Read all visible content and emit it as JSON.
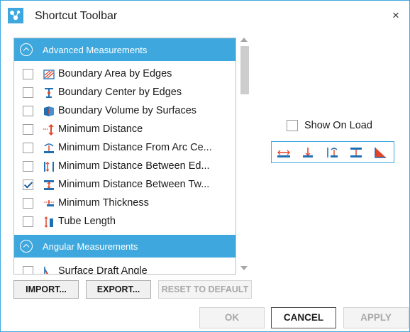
{
  "window": {
    "title": "Shortcut Toolbar",
    "close_glyph": "×",
    "app_icon": "toolbar-app-icon"
  },
  "groups": [
    {
      "label": "Advanced Measurements",
      "items": [
        {
          "label": "Boundary Area by Edges",
          "checked": false,
          "icon": "boundary-area-icon"
        },
        {
          "label": "Boundary Center by Edges",
          "checked": false,
          "icon": "boundary-center-icon"
        },
        {
          "label": "Boundary Volume by Surfaces",
          "checked": false,
          "icon": "boundary-volume-icon"
        },
        {
          "label": "Minimum Distance",
          "checked": false,
          "icon": "minimum-distance-icon"
        },
        {
          "label": "Minimum Distance From Arc Ce...",
          "checked": false,
          "icon": "min-distance-arc-icon"
        },
        {
          "label": "Minimum Distance Between Ed...",
          "checked": false,
          "icon": "min-distance-edges-icon"
        },
        {
          "label": "Minimum Distance Between Tw...",
          "checked": true,
          "icon": "min-distance-two-icon"
        },
        {
          "label": "Minimum Thickness",
          "checked": false,
          "icon": "minimum-thickness-icon"
        },
        {
          "label": "Tube Length",
          "checked": false,
          "icon": "tube-length-icon"
        }
      ]
    },
    {
      "label": "Angular Measurements",
      "items": [
        {
          "label": "Surface Draft Angle",
          "checked": false,
          "icon": "surface-draft-angle-icon"
        }
      ]
    }
  ],
  "show_on_load": {
    "label": "Show On Load",
    "checked": false
  },
  "preview_toolbar": {
    "icons": [
      "min-distance-between-two-icon",
      "min-distance-icon",
      "min-distance-arc-icon",
      "min-distance-edges-icon",
      "angle-icon"
    ]
  },
  "buttons": {
    "import": "IMPORT...",
    "export": "EXPORT...",
    "reset": "RESET TO DEFAULT",
    "ok": "OK",
    "cancel": "CANCEL",
    "apply": "APPLY"
  },
  "colors": {
    "accent": "#3ea8de",
    "icon_blue": "#1f6fb5",
    "icon_red": "#e0452b"
  }
}
